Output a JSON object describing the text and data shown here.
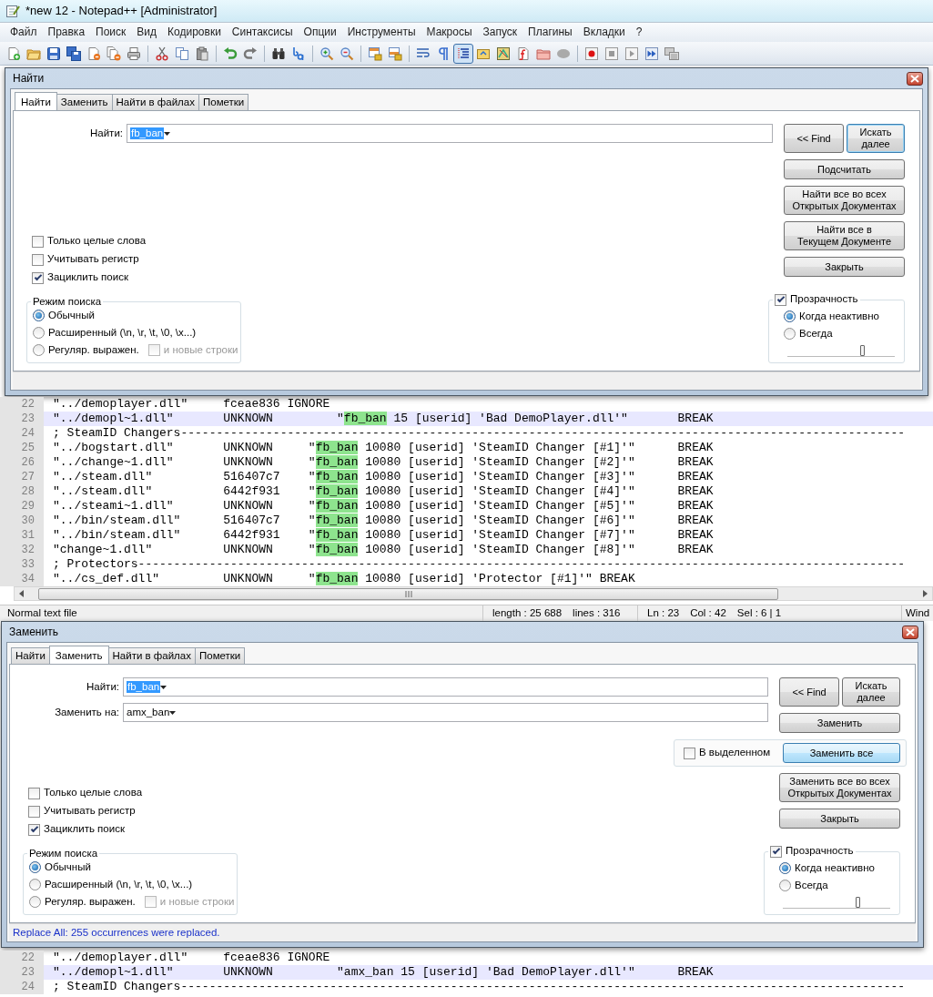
{
  "window": {
    "title": "*new 12 - Notepad++ [Administrator]"
  },
  "menu": [
    "Файл",
    "Правка",
    "Поиск",
    "Вид",
    "Кодировки",
    "Синтаксисы",
    "Опции",
    "Инструменты",
    "Макросы",
    "Запуск",
    "Плагины",
    "Вкладки",
    "?"
  ],
  "toolbar": [
    [
      {
        "pressed": false
      },
      {
        "pressed": false
      },
      {
        "pressed": false
      },
      {
        "pressed": false
      },
      {
        "pressed": false
      },
      {
        "pressed": false
      },
      {
        "pressed": false
      }
    ],
    [
      {
        "pressed": false
      },
      {
        "pressed": false
      },
      {
        "pressed": false
      }
    ],
    [
      {
        "pressed": false
      },
      {
        "pressed": false
      }
    ],
    [
      {
        "pressed": false
      },
      {
        "pressed": false
      }
    ],
    [
      {
        "pressed": false
      },
      {
        "pressed": false
      }
    ],
    [
      {
        "pressed": false
      },
      {
        "pressed": false
      }
    ],
    [
      {
        "pressed": false
      },
      {
        "pressed": false
      },
      {
        "pressed": true
      },
      {
        "pressed": false
      },
      {
        "pressed": false
      },
      {
        "pressed": false
      },
      {
        "pressed": false
      },
      {
        "pressed": false
      }
    ],
    [
      {
        "pressed": false
      },
      {
        "pressed": false
      },
      {
        "pressed": false
      },
      {
        "pressed": false
      },
      {
        "pressed": false
      }
    ]
  ],
  "find_dialog": {
    "title": "Найти",
    "tabs": [
      {
        "label": "Найти",
        "selected": true
      },
      {
        "label": "Заменить",
        "selected": false
      },
      {
        "label": "Найти в файлах",
        "selected": false
      },
      {
        "label": "Пометки",
        "selected": false
      }
    ],
    "fields": [
      {
        "label": "Найти:",
        "value": "fb_ban",
        "text_selected": true
      }
    ],
    "button_rows": [
      {
        "kind": "buttons",
        "buttons": [
          {
            "label": "<< Find",
            "default": false,
            "hot": false
          },
          {
            "label": "Искать\nдалее",
            "default": true,
            "hot": false
          }
        ]
      },
      {
        "kind": "buttons",
        "buttons": [
          {
            "label": "Подсчитать",
            "default": false,
            "hot": false
          }
        ]
      },
      {
        "kind": "buttons",
        "buttons": [
          {
            "label": "Найти все во всех\nОткрытых Документах",
            "default": false,
            "hot": false
          }
        ]
      },
      {
        "kind": "buttons",
        "buttons": [
          {
            "label": "Найти все в\nТекущем Документе",
            "default": false,
            "hot": false
          }
        ]
      },
      {
        "kind": "buttons",
        "buttons": [
          {
            "label": "Закрыть",
            "default": false,
            "hot": false
          }
        ]
      }
    ],
    "options": [
      {
        "label": "Только целые слова",
        "checked": false
      },
      {
        "label": "Учитывать регистр",
        "checked": false
      },
      {
        "label": "Зациклить поиск",
        "checked": true
      }
    ],
    "search_mode": {
      "title": "Режим поиска",
      "modes": [
        {
          "label": "Обычный",
          "selected": true
        },
        {
          "label": "Расширенный (\\n, \\r, \\t, \\0, \\x...)",
          "selected": false
        },
        {
          "label": "Регуляр. выражен.",
          "selected": false
        }
      ],
      "newlines": {
        "label": "и новые строки",
        "checked": false,
        "disabled": true
      }
    },
    "transparency": {
      "label": "Прозрачность",
      "checked": true,
      "modes": [
        {
          "label": "Когда неактивно",
          "selected": true
        },
        {
          "label": "Всегда",
          "selected": false
        }
      ],
      "level": 0.7
    }
  },
  "editor_top": {
    "lines": [
      {
        "number": "22",
        "current": false,
        "segments": [
          {
            "text": "\"../demoplayer.dll\"     fceae836 IGNORE",
            "highlight": false
          }
        ]
      },
      {
        "number": "23",
        "current": true,
        "segments": [
          {
            "text": "\"../demopl~1.dll\"       UNKNOWN         \"",
            "highlight": false
          },
          {
            "text": "fb_ban",
            "highlight": true
          },
          {
            "text": " 15 [userid] 'Bad DemoPlayer.dll'\"       BREAK",
            "highlight": false
          }
        ]
      },
      {
        "number": "24",
        "current": false,
        "segments": [
          {
            "text": "; SteamID Changers------------------------------------------------------------------------------------------------------",
            "highlight": false
          }
        ]
      },
      {
        "number": "25",
        "current": false,
        "segments": [
          {
            "text": "\"../bogstart.dll\"       UNKNOWN     \"",
            "highlight": false
          },
          {
            "text": "fb_ban",
            "highlight": true
          },
          {
            "text": " 10080 [userid] 'SteamID Changer [#1]'\"      BREAK",
            "highlight": false
          }
        ]
      },
      {
        "number": "26",
        "current": false,
        "segments": [
          {
            "text": "\"../change~1.dll\"       UNKNOWN     \"",
            "highlight": false
          },
          {
            "text": "fb_ban",
            "highlight": true
          },
          {
            "text": " 10080 [userid] 'SteamID Changer [#2]'\"      BREAK",
            "highlight": false
          }
        ]
      },
      {
        "number": "27",
        "current": false,
        "segments": [
          {
            "text": "\"../steam.dll\"          516407c7    \"",
            "highlight": false
          },
          {
            "text": "fb_ban",
            "highlight": true
          },
          {
            "text": " 10080 [userid] 'SteamID Changer [#3]'\"      BREAK",
            "highlight": false
          }
        ]
      },
      {
        "number": "28",
        "current": false,
        "segments": [
          {
            "text": "\"../steam.dll\"          6442f931    \"",
            "highlight": false
          },
          {
            "text": "fb_ban",
            "highlight": true
          },
          {
            "text": " 10080 [userid] 'SteamID Changer [#4]'\"      BREAK",
            "highlight": false
          }
        ]
      },
      {
        "number": "29",
        "current": false,
        "segments": [
          {
            "text": "\"../steami~1.dll\"       UNKNOWN     \"",
            "highlight": false
          },
          {
            "text": "fb_ban",
            "highlight": true
          },
          {
            "text": " 10080 [userid] 'SteamID Changer [#5]'\"      BREAK",
            "highlight": false
          }
        ]
      },
      {
        "number": "30",
        "current": false,
        "segments": [
          {
            "text": "\"../bin/steam.dll\"      516407c7    \"",
            "highlight": false
          },
          {
            "text": "fb_ban",
            "highlight": true
          },
          {
            "text": " 10080 [userid] 'SteamID Changer [#6]'\"      BREAK",
            "highlight": false
          }
        ]
      },
      {
        "number": "31",
        "current": false,
        "segments": [
          {
            "text": "\"../bin/steam.dll\"      6442f931    \"",
            "highlight": false
          },
          {
            "text": "fb_ban",
            "highlight": true
          },
          {
            "text": " 10080 [userid] 'SteamID Changer [#7]'\"      BREAK",
            "highlight": false
          }
        ]
      },
      {
        "number": "32",
        "current": false,
        "segments": [
          {
            "text": "\"change~1.dll\"          UNKNOWN     \"",
            "highlight": false
          },
          {
            "text": "fb_ban",
            "highlight": true
          },
          {
            "text": " 10080 [userid] 'SteamID Changer [#8]'\"      BREAK",
            "highlight": false
          }
        ]
      },
      {
        "number": "33",
        "current": false,
        "segments": [
          {
            "text": "; Protectors------------------------------------------------------------------------------------------------------------",
            "highlight": false
          }
        ]
      },
      {
        "number": "34",
        "current": false,
        "segments": [
          {
            "text": "\"../cs_def.dll\"         UNKNOWN     \"",
            "highlight": false
          },
          {
            "text": "fb_ban",
            "highlight": true
          },
          {
            "text": " 10080 [userid] 'Protector [#1]'\" BREAK",
            "highlight": false
          }
        ]
      }
    ]
  },
  "status_bar": {
    "file_type": "Normal text file",
    "length": "length : 25 688",
    "lines": "lines : 316",
    "position": [
      "Ln : 23",
      "Col : 42",
      "Sel : 6 | 1"
    ],
    "mode": "Wind"
  },
  "replace_dialog": {
    "title": "Заменить",
    "tabs": [
      {
        "label": "Найти",
        "selected": false
      },
      {
        "label": "Заменить",
        "selected": true
      },
      {
        "label": "Найти в файлах",
        "selected": false
      },
      {
        "label": "Пометки",
        "selected": false
      }
    ],
    "fields": [
      {
        "label": "Найти:",
        "value": "fb_ban",
        "text_selected": true
      },
      {
        "label": "Заменить на:",
        "value": "amx_ban",
        "text_selected": false
      }
    ],
    "button_rows": [
      {
        "kind": "buttons",
        "buttons": [
          {
            "label": "<< Find",
            "default": false,
            "hot": false
          },
          {
            "label": "Искать\nдалее",
            "default": false,
            "hot": false
          }
        ]
      },
      {
        "kind": "buttons",
        "buttons": [
          {
            "label": "Заменить",
            "default": false,
            "hot": false
          }
        ]
      },
      {
        "kind": "selection",
        "checkbox": {
          "label": "В выделенном",
          "checked": false
        },
        "buttons": [
          {
            "label": "Заменить все",
            "default": false,
            "hot": true
          }
        ]
      },
      {
        "kind": "buttons",
        "buttons": [
          {
            "label": "Заменить все во всех\nОткрытых Документах",
            "default": false,
            "hot": false
          }
        ]
      },
      {
        "kind": "buttons",
        "buttons": [
          {
            "label": "Закрыть",
            "default": false,
            "hot": false
          }
        ]
      }
    ],
    "options": [
      {
        "label": "Только целые слова",
        "checked": false
      },
      {
        "label": "Учитывать регистр",
        "checked": false
      },
      {
        "label": "Зациклить поиск",
        "checked": true
      }
    ],
    "search_mode": {
      "title": "Режим поиска",
      "modes": [
        {
          "label": "Обычный",
          "selected": true
        },
        {
          "label": "Расширенный (\\n, \\r, \\t, \\0, \\x...)",
          "selected": false
        },
        {
          "label": "Регуляр. выражен.",
          "selected": false
        }
      ],
      "newlines": {
        "label": "и новые строки",
        "checked": false,
        "disabled": true
      }
    },
    "transparency": {
      "label": "Прозрачность",
      "checked": true,
      "modes": [
        {
          "label": "Когда неактивно",
          "selected": true
        },
        {
          "label": "Всегда",
          "selected": false
        }
      ],
      "level": 0.7
    },
    "status": "Replace All: 255 occurrences were replaced."
  },
  "editor_bottom": {
    "lines": [
      {
        "number": "22",
        "current": false,
        "segments": [
          {
            "text": "\"../demoplayer.dll\"     fceae836 IGNORE",
            "highlight": false
          }
        ]
      },
      {
        "number": "23",
        "current": true,
        "segments": [
          {
            "text": "\"../demopl~1.dll\"       UNKNOWN         \"amx_ban 15 [userid] 'Bad DemoPlayer.dll'\"      BREAK",
            "highlight": false
          }
        ]
      },
      {
        "number": "24",
        "current": false,
        "segments": [
          {
            "text": "; SteamID Changers------------------------------------------------------------------------------------------------------",
            "highlight": false
          }
        ]
      }
    ]
  }
}
